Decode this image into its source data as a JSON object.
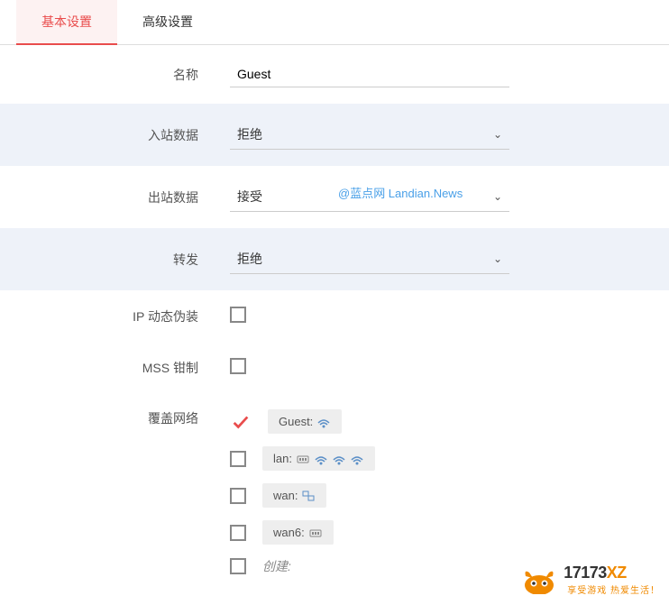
{
  "tabs": {
    "basic": "基本设置",
    "advanced": "高级设置"
  },
  "fields": {
    "name_label": "名称",
    "name_value": "Guest",
    "inbound_label": "入站数据",
    "inbound_value": "拒绝",
    "outbound_label": "出站数据",
    "outbound_value": "接受",
    "forward_label": "转发",
    "forward_value": "拒绝",
    "masq_label": "IP 动态伪装",
    "mss_label": "MSS 钳制",
    "cover_label": "覆盖网络"
  },
  "networks": {
    "guest": "Guest:",
    "lan": "lan:",
    "wan": "wan:",
    "wan6": "wan6:",
    "create": "创建:"
  },
  "watermark": "@蓝点网 Landian.News",
  "logo": {
    "main": "17173",
    "xz": "XZ",
    "sub": "享受游戏 热爱生活！"
  }
}
